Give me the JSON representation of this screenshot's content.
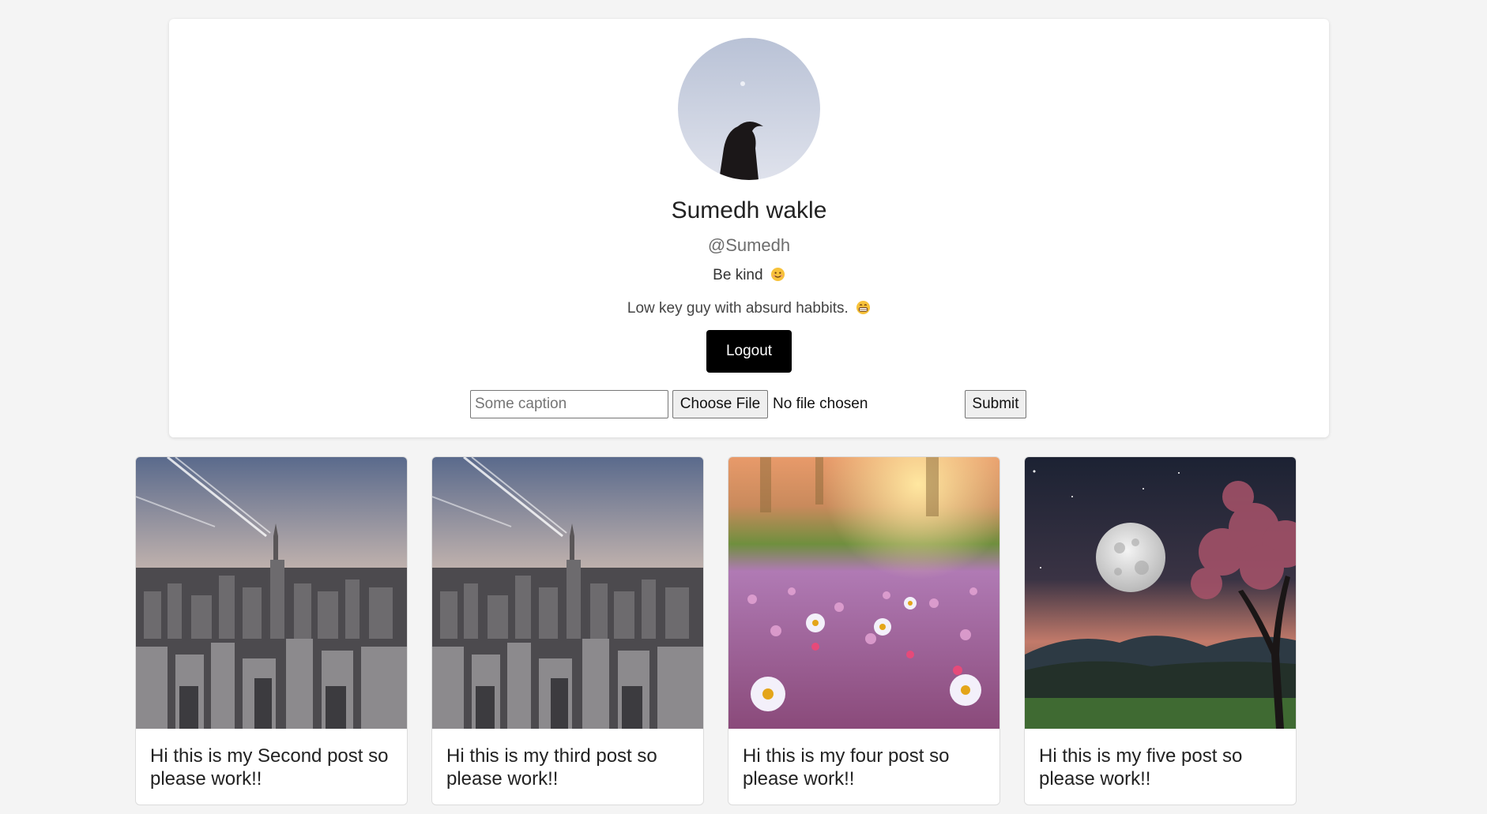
{
  "profile": {
    "name": "Sumedh wakle",
    "handle": "@Sumedh",
    "status": "Be kind",
    "status_emoji": "smiling-face-icon",
    "bio": "Low key guy with absurd habbits.",
    "bio_emoji": "grinning-face-icon",
    "logout_label": "Logout"
  },
  "upload": {
    "caption_placeholder": "Some caption",
    "choose_file_label": "Choose File",
    "file_status": "No file chosen",
    "submit_label": "Submit"
  },
  "posts": [
    {
      "caption": "Hi this is my Second post so please work!!",
      "image": "city-skyline-sunset"
    },
    {
      "caption": "Hi this is my third post so please work!!",
      "image": "city-skyline-sunset"
    },
    {
      "caption": "Hi this is my four post so please work!!",
      "image": "flower-field"
    },
    {
      "caption": "Hi this is my five post so please work!!",
      "image": "full-moon-tree-night"
    }
  ],
  "colors": {
    "background": "#f4f4f4",
    "card": "#ffffff",
    "logout_button": "#000000"
  }
}
